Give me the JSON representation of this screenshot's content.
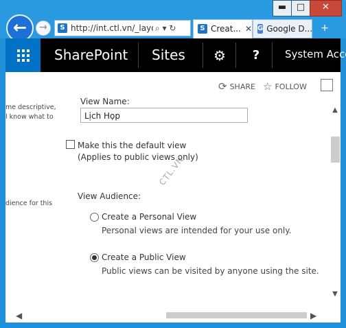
{
  "window": {
    "minimize": "▬",
    "maximize": "□",
    "close": "✕"
  },
  "browser": {
    "back_icon": "←",
    "forward_icon": "→",
    "address": "http://int.ctl.vn/_layou",
    "address_controls": "⌕ ▾ ↻",
    "tabs": [
      {
        "label": "Creat...",
        "close": "✕"
      },
      {
        "label": "Google D..."
      }
    ],
    "new_tab_icon": "+"
  },
  "suite_bar": {
    "brand": "SharePoint",
    "sites": "Sites",
    "settings_icon": "⚙",
    "help_icon": "?",
    "account": "System Acco"
  },
  "commands": {
    "share": "SHARE",
    "follow": "FOLLOW"
  },
  "left_help": {
    "line1": "me descriptive,",
    "line2": "l know what to",
    "line3": "dience for this"
  },
  "form": {
    "view_name_label": "View Name:",
    "view_name_value": "Lịch Họp",
    "default_view_label": "Make this the default view",
    "default_view_note": "(Applies to public views only)",
    "audience_label": "View Audience:",
    "personal_label": "Create a Personal View",
    "personal_desc": "Personal views are intended for your use only.",
    "public_label": "Create a Public View",
    "public_desc": "Public views can be visited by anyone using the site.",
    "selected_audience": "public"
  },
  "watermark": "CTL.VN"
}
